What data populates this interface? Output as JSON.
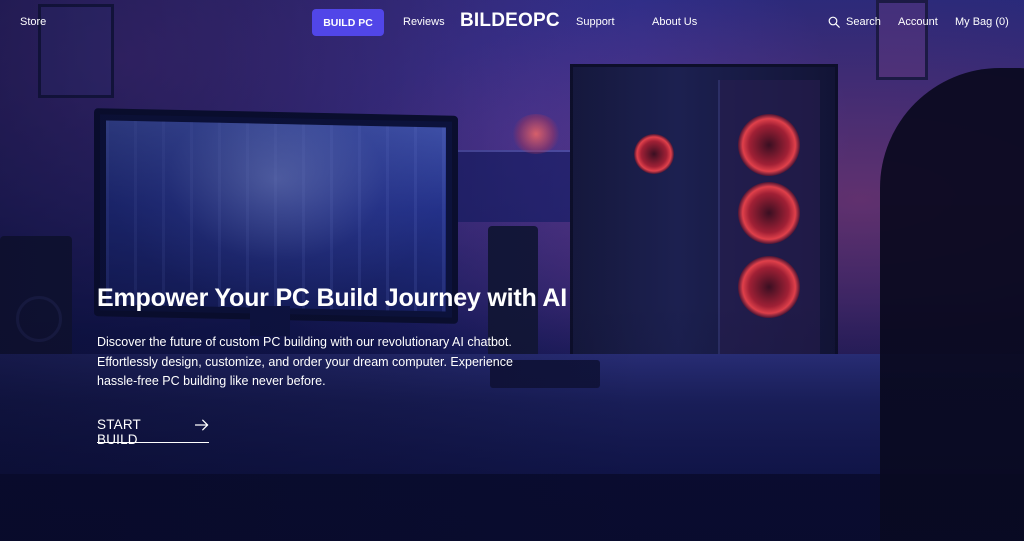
{
  "nav": {
    "store": "Store",
    "build_pc": "BUILD PC",
    "reviews": "Reviews",
    "brand": "BILDEOPC",
    "support": "Support",
    "about": "About Us",
    "search_icon": "search-icon",
    "search": "Search",
    "account": "Account",
    "bag": "My Bag (0)"
  },
  "hero": {
    "title": "Empower Your PC Build Journey with AI",
    "description_lines": [
      "Discover the future of custom PC building with our revolutionary AI chatbot.",
      "Effortlessly design, customize, and order your dream computer. Experience",
      "hassle-free PC building like never before."
    ],
    "cta_label": "START BUILD",
    "cta_icon": "arrow-right-icon"
  },
  "colors": {
    "accent": "#5146e8",
    "text": "#ffffff",
    "background": "#1e2268"
  }
}
